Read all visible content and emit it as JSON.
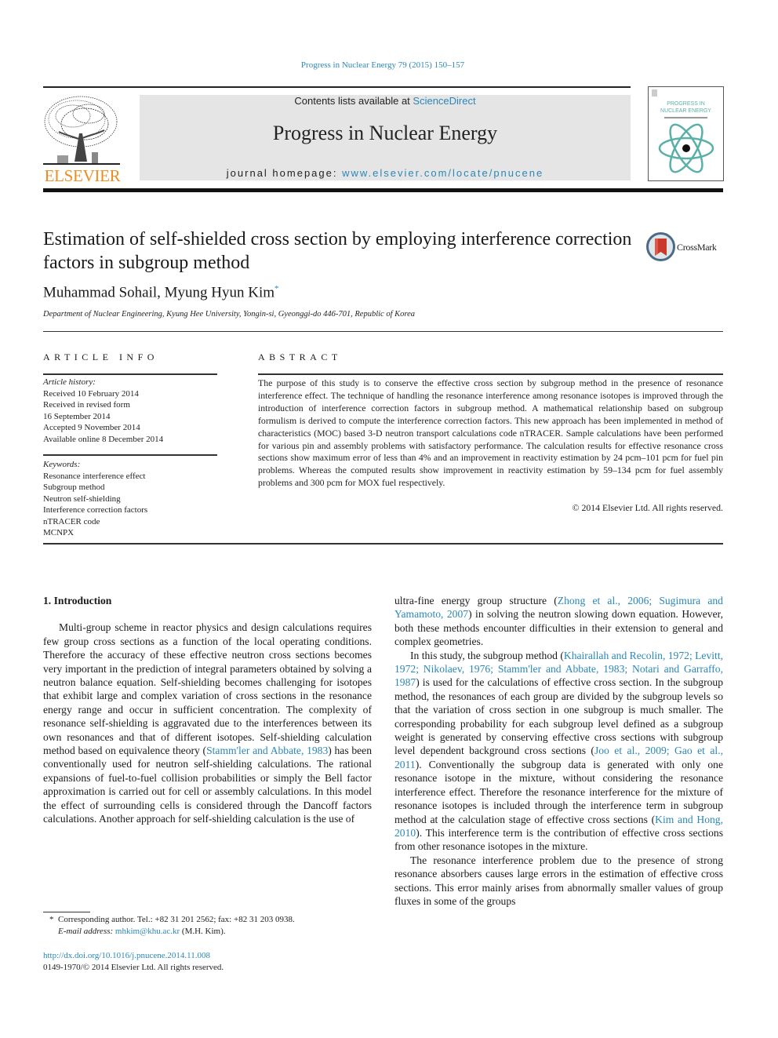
{
  "header": {
    "citation": "Progress in Nuclear Energy 79 (2015) 150–157",
    "publisher_logo": "elsevier-tree-logo",
    "publisher_name": "ELSEVIER",
    "contents_prefix": "Contents lists available at ",
    "contents_link": "ScienceDirect",
    "journal_title": "Progress in Nuclear Energy",
    "homepage_prefix": "journal homepage: ",
    "homepage_link": "www.elsevier.com/locate/pnucene",
    "cover_title_line1": "PROGRESS IN",
    "cover_title_line2": "NUCLEAR ENERGY",
    "cover_icon": "atom-icon"
  },
  "article": {
    "title": "Estimation of self-shielded cross section by employing interference correction factors in subgroup method",
    "crossmark_label": "CrossMark",
    "authors": "Muhammad Sohail, Myung Hyun Kim",
    "corresponding_mark": "*",
    "affiliation": "Department of Nuclear Engineering, Kyung Hee University, Yongin-si, Gyeonggi-do 446-701, Republic of Korea"
  },
  "article_info": {
    "heading": "ARTICLE INFO",
    "history_label": "Article history:",
    "history": [
      "Received 10 February 2014",
      "Received in revised form",
      "16 September 2014",
      "Accepted 9 November 2014",
      "Available online 8 December 2014"
    ],
    "keywords_label": "Keywords:",
    "keywords": [
      "Resonance interference effect",
      "Subgroup method",
      "Neutron self-shielding",
      "Interference correction factors",
      "nTRACER code",
      "MCNPX"
    ]
  },
  "abstract": {
    "heading": "ABSTRACT",
    "text": "The purpose of this study is to conserve the effective cross section by subgroup method in the presence of resonance interference effect. The technique of handling the resonance interference among resonance isotopes is improved through the introduction of interference correction factors in subgroup method. A mathematical relationship based on subgroup formulism is derived to compute the interference correction factors. This new approach has been implemented in method of characteristics (MOC) based 3-D neutron transport calculations code nTRACER. Sample calculations have been performed for various pin and assembly problems with satisfactory performance. The calculation results for effective resonance cross sections show maximum error of less than 4% and an improvement in reactivity estimation by 24 pcm–101 pcm for fuel pin problems. Whereas the computed results show improvement in reactivity estimation by 59–134 pcm for fuel assembly problems and 300 pcm for MOX fuel respectively.",
    "copyright": "© 2014 Elsevier Ltd. All rights reserved."
  },
  "body": {
    "section_heading": "1.  Introduction",
    "left_p1": "Multi-group scheme in reactor physics and design calculations requires few group cross sections as a function of the local operating conditions. Therefore the accuracy of these effective neutron cross sections becomes very important in the prediction of integral parameters obtained by solving a neutron balance equation. Self-shielding becomes challenging for isotopes that exhibit large and complex variation of cross sections in the resonance energy range and occur in sufficient concentration. The complexity of resonance self-shielding is aggravated due to the interferences between its own resonances and that of different isotopes. Self-shielding calculation method based on equivalence theory (",
    "left_ref1": "Stamm'ler and Abbate, 1983",
    "left_p1_tail": ") has been conventionally used for neutron self-shielding calculations. The rational expansions of fuel-to-fuel collision probabilities or simply the Bell factor approximation is carried out for cell or assembly calculations. In this model the effect of surrounding cells is considered through the Dancoff factors calculations. Another approach for self-shielding calculation is the use of",
    "right_p0_head": "ultra-fine energy group structure (",
    "right_ref0": "Zhong et al., 2006; Sugimura and Yamamoto, 2007",
    "right_p0_tail": ") in solving the neutron slowing down equation. However, both these methods encounter difficulties in their extension to general and complex geometries.",
    "right_p1_head": "In this study, the subgroup method (",
    "right_ref1": "Khairallah and Recolin, 1972; Levitt, 1972; Nikolaev, 1976; Stamm'ler and Abbate, 1983; Notari and Garraffo, 1987",
    "right_p1_mid": ") is used for the calculations of effective cross section. In the subgroup method, the resonances of each group are divided by the subgroup levels so that the variation of cross section in one subgroup is much smaller. The corresponding probability for each subgroup level defined as a subgroup weight is generated by conserving effective cross sections with subgroup level dependent background cross sections (",
    "right_ref2": "Joo et al., 2009; Gao et al., 2011",
    "right_p1_mid2": "). Conventionally the subgroup data is generated with only one resonance isotope in the mixture, without considering the resonance interference effect. Therefore the resonance interference for the mixture of resonance isotopes is included through the interference term in subgroup method at the calculation stage of effective cross sections (",
    "right_ref3": "Kim and Hong, 2010",
    "right_p1_tail": "). This interference term is the contribution of effective cross sections from other resonance isotopes in the mixture.",
    "right_p2": "The resonance interference problem due to the presence of strong resonance absorbers causes large errors in the estimation of effective cross sections. This error mainly arises from abnormally smaller values of group fluxes in some of the groups"
  },
  "footnote": {
    "mark": "*",
    "corresponding": "Corresponding author. Tel.: +82 31 201 2562; fax: +82 31 203 0938.",
    "email_label": "E-mail address: ",
    "email": "mhkim@khu.ac.kr",
    "email_tail": " (M.H. Kim).",
    "doi": "http://dx.doi.org/10.1016/j.pnucene.2014.11.008",
    "issn_rights": "0149-1970/© 2014 Elsevier Ltd. All rights reserved."
  },
  "colors": {
    "link": "#2a87b8",
    "elsevier_orange": "#f28a1e",
    "banner_gray": "#e5e5e5",
    "cover_teal": "#5ab0a8",
    "crossmark_red": "#c8392b"
  }
}
